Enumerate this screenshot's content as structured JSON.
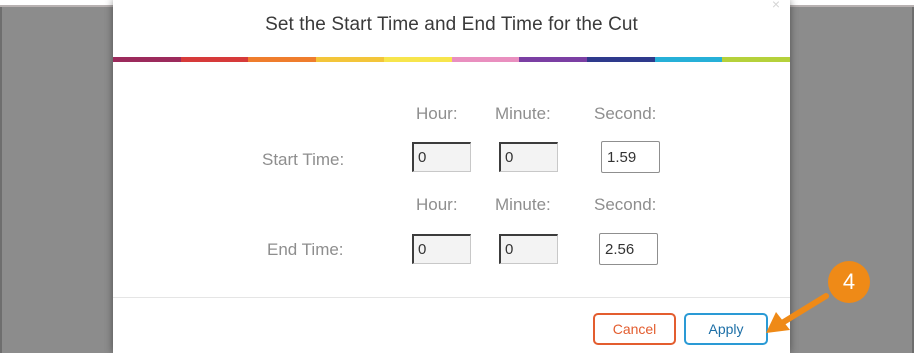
{
  "dialog": {
    "title": "Set the Start Time and End Time for the Cut",
    "close_glyph": "×",
    "color_bar": [
      "#9c2a5c",
      "#d63a3a",
      "#ef7d2d",
      "#f3c53a",
      "#f7e54c",
      "#e98fbf",
      "#7b3fa3",
      "#2e3a8c",
      "#26b0d8",
      "#b5d13b"
    ]
  },
  "start": {
    "label": "Start Time:",
    "headers": {
      "hour": "Hour:",
      "minute": "Minute:",
      "second": "Second:"
    },
    "hour": "0",
    "minute": "0",
    "second": "1.59"
  },
  "end": {
    "label": "End Time:",
    "headers": {
      "hour": "Hour:",
      "minute": "Minute:",
      "second": "Second:"
    },
    "hour": "0",
    "minute": "0",
    "second": "2.56"
  },
  "buttons": {
    "cancel": "Cancel",
    "apply": "Apply"
  },
  "annotation": {
    "step_number": "4",
    "badge_color": "#ef8a17"
  }
}
